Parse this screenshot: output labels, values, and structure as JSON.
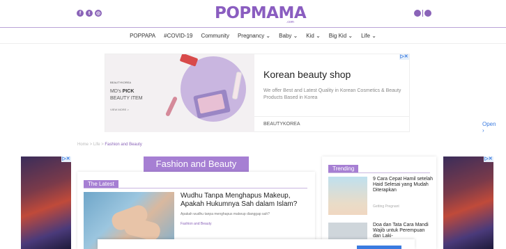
{
  "header": {
    "logo": "POPMAMA",
    "logo_sub": ".com",
    "social_icons": [
      "facebook-icon",
      "twitter-icon",
      "instagram-icon"
    ],
    "right_icons": [
      "search-icon",
      "user-icon"
    ]
  },
  "nav": {
    "items": [
      "POPPAPA",
      "#COVID-19",
      "Community",
      "Pregnancy ⌄",
      "Baby ⌄",
      "Kid ⌄",
      "Big Kid ⌄",
      "Life ⌄"
    ]
  },
  "ad_top": {
    "brand_small": "BEAUTYKOREA",
    "mds_line1": "MD's ",
    "mds_pick": "PICK",
    "mds_line2": "BEAUTY ITEM",
    "view_more": "VIEW MORE >",
    "title": "Korean beauty shop",
    "description": "We offer Best and Latest Quality in Korean Cosmetics & Beauty Products Based in Korea",
    "brand": "BEAUTYKOREA",
    "cta": "Open  ›",
    "adchoice": "▷✕"
  },
  "breadcrumb": {
    "home": "Home",
    "sep1": " > ",
    "life": "Life",
    "sep2": " > ",
    "current": "Fashion and Beauty"
  },
  "main": {
    "section_title": "Fashion and Beauty",
    "latest_tag": "The Latest",
    "article_title": "Wudhu Tanpa Menghapus Makeup, Apakah Hukumnya Sah dalam Islam?",
    "article_desc": "Apakah wudhu tanpa menghapus makeup dianggap sah?",
    "article_category": "Fashion and Beauty"
  },
  "trending": {
    "tag": "Trending",
    "items": [
      {
        "title": "9 Cara Cepat Hamil setelah Haid Selesai yang Mudah Diterapkan",
        "category": "Getting Pregnant"
      },
      {
        "title": "Doa dan Tata Cara Mandi Wajib untuk Perempuan dan Laki-",
        "category": ""
      }
    ]
  },
  "side_ads": {
    "adchoice": "▷✕"
  },
  "colors": {
    "accent": "#8a63b8",
    "tag_bg": "#a67fd3",
    "link": "#3a7be0"
  }
}
